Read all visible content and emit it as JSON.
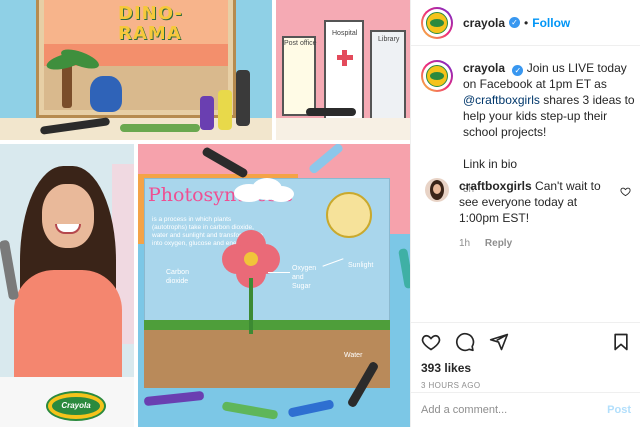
{
  "post": {
    "image": {
      "tile1_title": "DINO-\nRAMA",
      "tile2_labels": [
        "Post office",
        "Hospital",
        "Library"
      ],
      "tile3_logo": "Crayola",
      "tile4": {
        "title": "Photosynthesis",
        "text": "is a process in which plants (autotrophs) take in carbon dioxide, water and sunlight and transform them into oxygen, glucose and energy.",
        "labels": {
          "carbon_dioxide": "Carbon\ndioxide",
          "oxygen_sugar": "Oxygen\nand\nSugar",
          "sunlight": "Sunlight",
          "water": "Water"
        }
      }
    },
    "header": {
      "username": "crayola",
      "verified_mark": "✓",
      "separator": "•",
      "follow_label": "Follow"
    },
    "caption": {
      "username": "crayola",
      "text_before": "Join us LIVE today on Facebook at 1pm ET as ",
      "mention": "@craftboxgirls",
      "text_after": " shares 3 ideas to help your kids step-up their school projects!",
      "link_line": "Link in bio",
      "age": "3h"
    },
    "comments": [
      {
        "username": "craftboxgirls",
        "text": "Can't wait to see everyone today at 1:00pm EST!",
        "age": "1h",
        "reply_label": "Reply"
      }
    ],
    "actions": {
      "icons": [
        "heart-icon",
        "comment-icon",
        "share-icon",
        "bookmark-icon"
      ],
      "likes": "393 likes",
      "timestamp": "3 HOURS AGO"
    },
    "add_comment": {
      "placeholder": "Add a comment...",
      "post_label": "Post"
    }
  }
}
